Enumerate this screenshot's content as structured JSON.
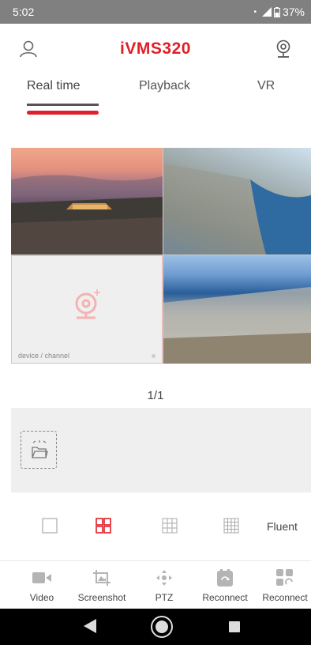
{
  "status_bar": {
    "time": "5:02",
    "battery": "37%"
  },
  "header": {
    "title": "iVMS320"
  },
  "tabs": [
    {
      "label": "Real time",
      "active": true
    },
    {
      "label": "Playback",
      "active": false
    },
    {
      "label": "VR",
      "active": false
    }
  ],
  "video_grid": {
    "empty_cell_label": "device / channel"
  },
  "pagination": {
    "text": "1/1"
  },
  "layout_options": {
    "fluent_label": "Fluent",
    "selected": "4-split"
  },
  "toolbar": [
    {
      "label": "Video",
      "icon": "video-icon"
    },
    {
      "label": "Screenshot",
      "icon": "screenshot-icon"
    },
    {
      "label": "PTZ",
      "icon": "ptz-icon"
    },
    {
      "label": "Reconnect",
      "icon": "reconnect-icon"
    },
    {
      "label": "Reconnect",
      "icon": "reconnect-all-icon"
    }
  ],
  "colors": {
    "accent": "#e0202a",
    "status_bar": "#808080",
    "icon_gray": "#b4b4b4"
  }
}
